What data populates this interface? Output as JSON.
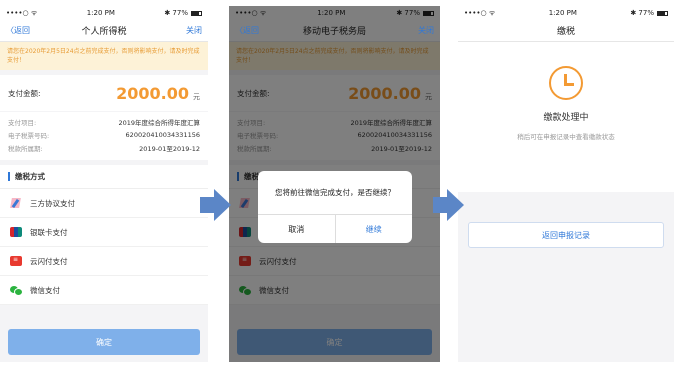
{
  "status": {
    "carrier": "••••○ ᯤ",
    "time": "1:20 PM",
    "battery": "✱ 77%"
  },
  "screen1": {
    "back": "〈返回",
    "title": "个人所得税",
    "close": "关闭",
    "notice": "请您在2020年2月5日24点之前完成支付，否则将影响支付，请及时完成支付！",
    "amount_label": "支付金额:",
    "amount": "2000.00",
    "unit": "元",
    "info": [
      {
        "k": "支付项目:",
        "v": "2019年度综合所得年度汇算"
      },
      {
        "k": "电子税票号码:",
        "v": "620020410034331156"
      },
      {
        "k": "税款所属期:",
        "v": "2019-01至2019-12"
      }
    ],
    "section_title": "缴税方式",
    "methods": [
      {
        "label": "三方协议支付",
        "icon": "pen-icon"
      },
      {
        "label": "银联卡支付",
        "icon": "unionpay-icon"
      },
      {
        "label": "云闪付支付",
        "icon": "cloud-pay-icon"
      },
      {
        "label": "微信支付",
        "icon": "wechat-icon"
      }
    ],
    "confirm": "确定"
  },
  "screen2": {
    "back": "〈返回",
    "title": "移动电子税务局",
    "close": "关闭",
    "section_title": "缴税",
    "dialog_message": "您将前往微信完成支付，是否继续？",
    "dialog_cancel": "取消",
    "dialog_ok": "继续"
  },
  "screen3": {
    "title": "缴税",
    "status_text": "缴款处理中",
    "sub_text": "稍后可在申报记录中查看缴款状态",
    "return_button": "返回申报记录"
  },
  "colors": {
    "accent": "#2f78d8",
    "amount": "#f39a33",
    "arrow": "#5b86c7"
  }
}
